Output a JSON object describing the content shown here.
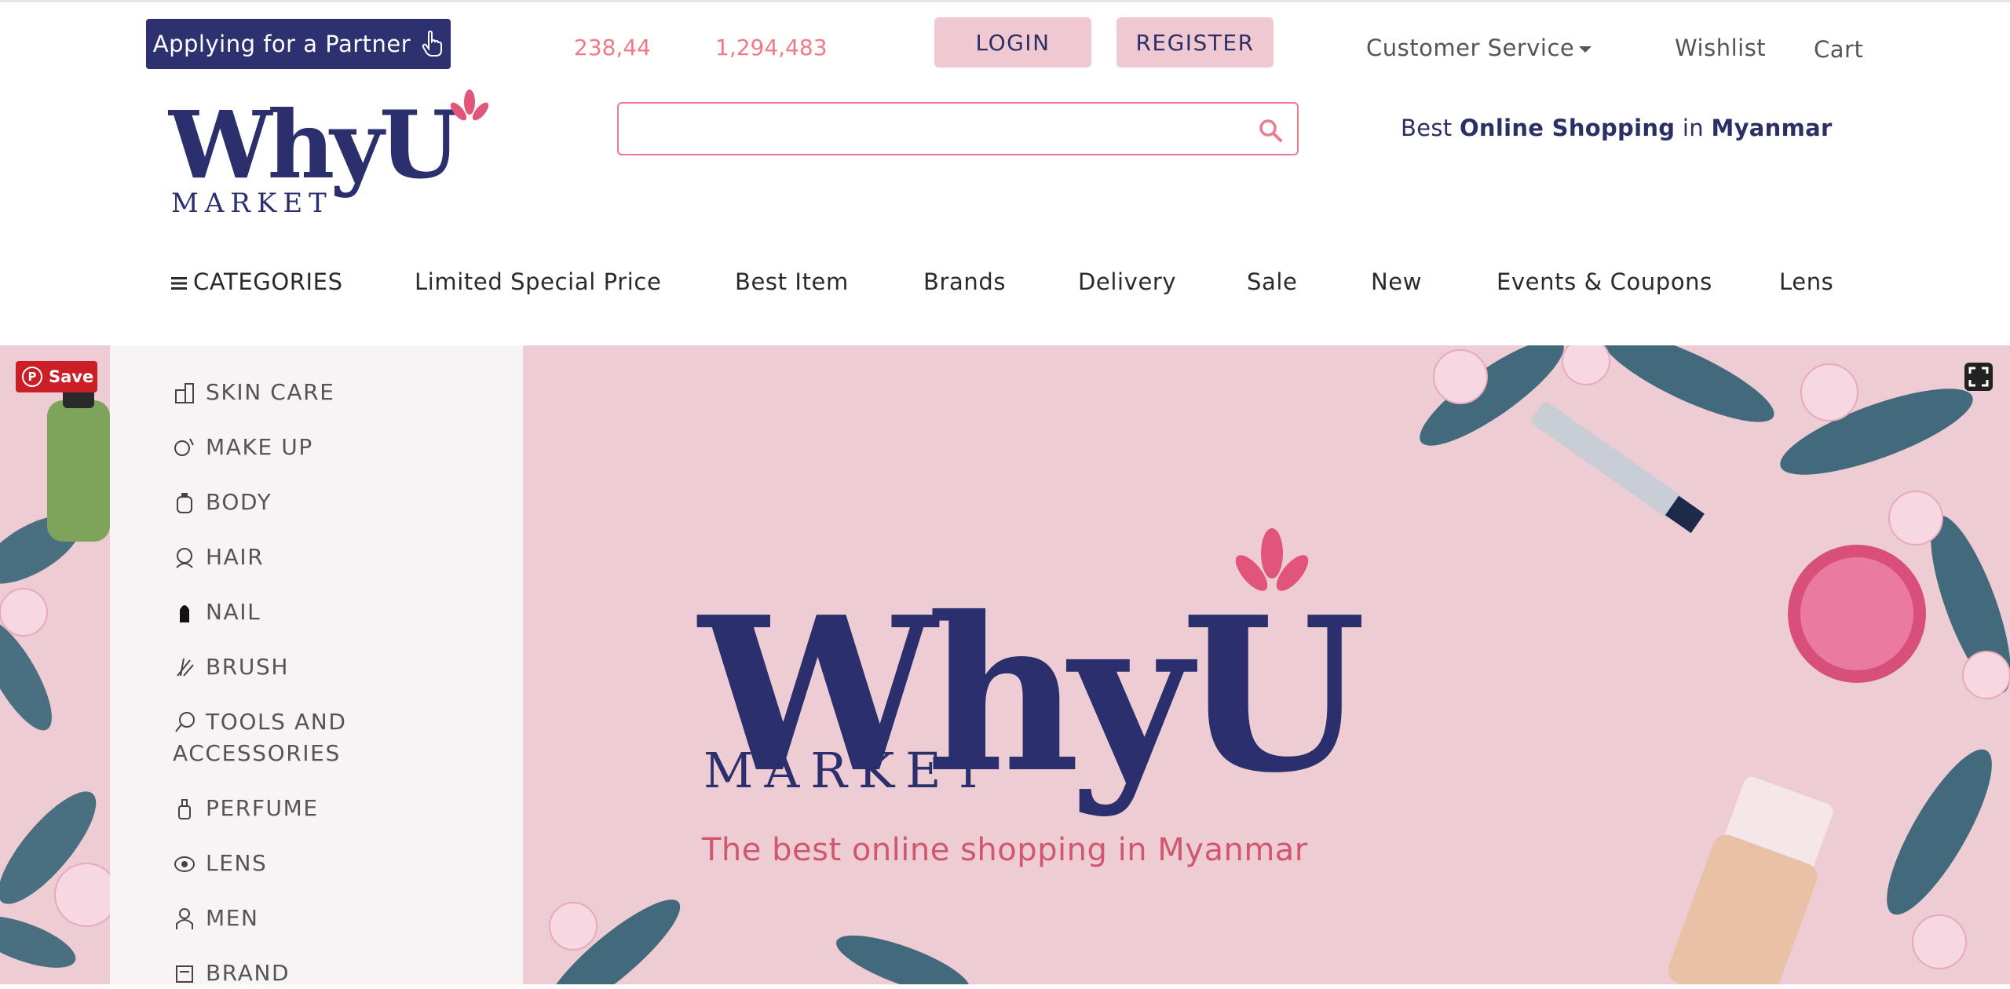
{
  "topbar": {
    "partner_label": "Applying for a Partner",
    "counter_1": "238,44",
    "counter_2": "1,294,483",
    "login_label": "LOGIN",
    "register_label": "REGISTER",
    "customer_service_label": "Customer Service",
    "wishlist_label": "Wishlist",
    "cart_label": "Cart"
  },
  "brand": {
    "logo_word": "WhyU",
    "logo_sub": "MARKET",
    "tagline_1": "Best ",
    "tagline_2": "Online Shopping",
    "tagline_3": " in ",
    "tagline_4": "Myanmar"
  },
  "search": {
    "placeholder": ""
  },
  "nav": {
    "categories_label": "CATEGORIES",
    "items": [
      "Limited Special Price",
      "Best Item",
      "Brands",
      "Delivery",
      "Sale",
      "New",
      "Events & Coupons",
      "Lens"
    ]
  },
  "sidebar": {
    "items": [
      {
        "label": "SKIN CARE",
        "icon": "skin-care-icon"
      },
      {
        "label": "MAKE UP",
        "icon": "make-up-icon"
      },
      {
        "label": "BODY",
        "icon": "body-icon"
      },
      {
        "label": "HAIR",
        "icon": "hair-icon"
      },
      {
        "label": "NAIL",
        "icon": "nail-icon"
      },
      {
        "label": "BRUSH",
        "icon": "brush-icon"
      },
      {
        "label": "TOOLS AND ACCESSORIES",
        "icon": "tools-icon"
      },
      {
        "label": "PERFUME",
        "icon": "perfume-icon"
      },
      {
        "label": "LENS",
        "icon": "lens-icon"
      },
      {
        "label": "MEN",
        "icon": "men-icon"
      },
      {
        "label": "BRAND",
        "icon": "brand-icon"
      }
    ]
  },
  "hero": {
    "logo_word": "WhyU",
    "logo_sub": "MARKET",
    "subtitle": "The best online shopping in Myanmar"
  },
  "pinterest": {
    "save_label": "Save"
  },
  "colors": {
    "brand_navy": "#2b2f6e",
    "brand_pink": "#e2557a",
    "hero_bg": "#eeccd4",
    "button_pink": "#efc8d1",
    "counter_pink": "#ef7b88"
  }
}
